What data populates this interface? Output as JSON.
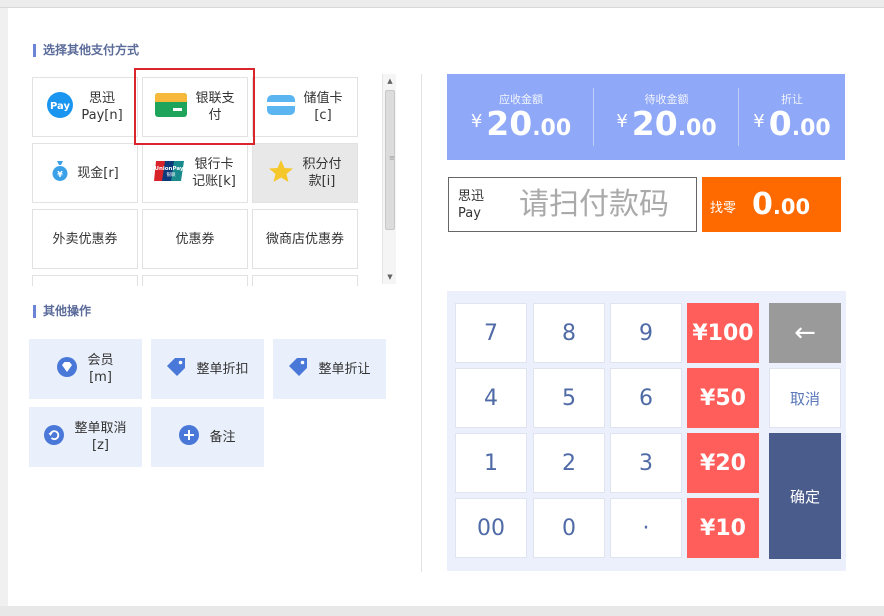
{
  "other_pay": {
    "title": "选择其他支付方式",
    "items": [
      {
        "label": "思迅\nPay[n]",
        "icon": "pay-logo-icon"
      },
      {
        "label": "银联支\n付",
        "icon": "bank-card-icon"
      },
      {
        "label": "储值卡\n[c]",
        "icon": "stored-card-icon"
      },
      {
        "label": "现金[r]",
        "icon": "money-bag-icon"
      },
      {
        "label": "银行卡\n记账[k]",
        "icon": "unionpay-icon",
        "icon_text": "UnionPay"
      },
      {
        "label": "积分付\n款[i]",
        "icon": "star-icon"
      },
      {
        "label": "外卖优惠券"
      },
      {
        "label": "优惠券"
      },
      {
        "label": "微商店优惠券"
      }
    ]
  },
  "other_ops": {
    "title": "其他操作",
    "items": [
      {
        "label": "会员\n[m]",
        "icon": "diamond-icon"
      },
      {
        "label": "整单折扣",
        "icon": "tag-icon"
      },
      {
        "label": "整单折让",
        "icon": "tag-icon"
      },
      {
        "label": "整单取消\n[z]",
        "icon": "undo-icon"
      },
      {
        "label": "备注",
        "icon": "plus-circle-icon"
      }
    ]
  },
  "summary": {
    "receivable": {
      "label": "应收金额",
      "currency": "¥",
      "int": "20",
      "dec": ".00"
    },
    "pending": {
      "label": "待收金额",
      "currency": "¥",
      "int": "20",
      "dec": ".00"
    },
    "discount": {
      "label": "折让",
      "currency": "¥",
      "int": "0",
      "dec": ".00"
    }
  },
  "scan": {
    "label": "思迅\nPay",
    "placeholder": "请扫付款码"
  },
  "change": {
    "label": "找零",
    "int": "0",
    "dec": ".00"
  },
  "keypad": {
    "digits": [
      "7",
      "8",
      "9",
      "4",
      "5",
      "6",
      "1",
      "2",
      "3",
      "00",
      "0",
      "·"
    ],
    "money": [
      "¥100",
      "¥50",
      "¥20",
      "¥10"
    ],
    "backspace": "←",
    "cancel": "取消",
    "confirm": "确定"
  },
  "colors": {
    "accent_blue": "#8fa8f7",
    "change_orange": "#ff6a00",
    "money_red": "#ff5e5b",
    "confirm_navy": "#4a5c8c",
    "selected_border": "#d9252c"
  }
}
